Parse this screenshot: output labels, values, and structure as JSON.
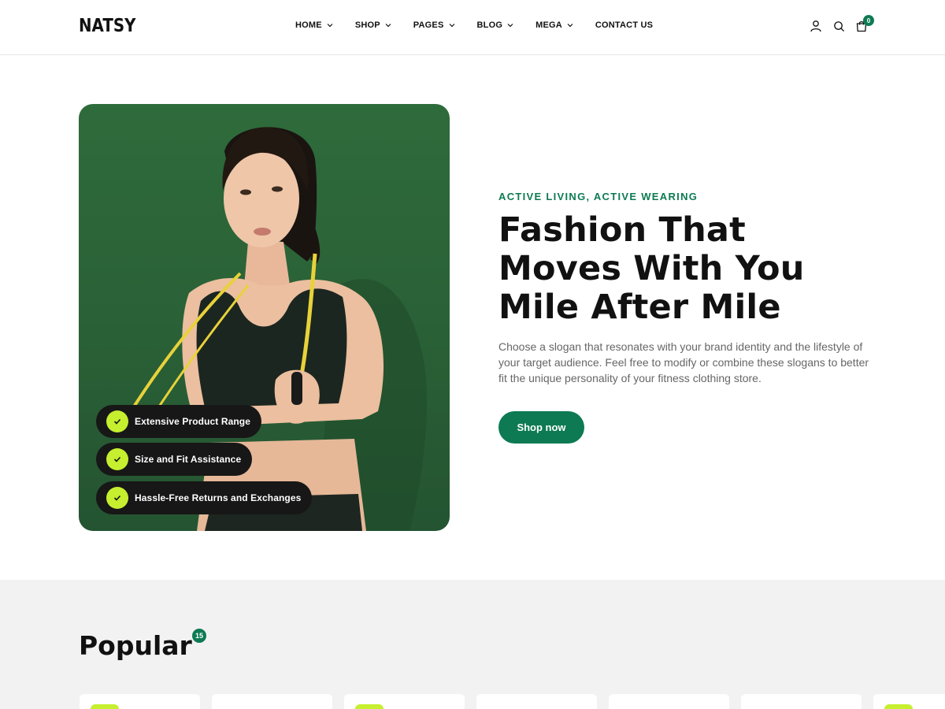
{
  "brand": {
    "logo": "NATSY"
  },
  "nav": {
    "items": [
      {
        "label": "HOME",
        "dropdown": true
      },
      {
        "label": "SHOP",
        "dropdown": true
      },
      {
        "label": "PAGES",
        "dropdown": true
      },
      {
        "label": "BLOG",
        "dropdown": true
      },
      {
        "label": "MEGA",
        "dropdown": true
      },
      {
        "label": "CONTACT US",
        "dropdown": false
      }
    ]
  },
  "header_icons": {
    "account": "user-icon",
    "search": "search-icon",
    "cart": "shopping-bag-icon",
    "cart_count": "0"
  },
  "hero": {
    "eyebrow": "ACTIVE LIVING, ACTIVE WEARING",
    "headline": [
      "Fashion That",
      "Moves With You",
      "Mile After Mile"
    ],
    "description": "Choose a slogan that resonates with your brand identity and the lifestyle of your target audience. Feel free to modify or combine these slogans to better fit the unique personality of your fitness clothing store.",
    "cta_label": "Shop now",
    "features": [
      "Extensive Product Range",
      "Size and Fit Assistance",
      "Hassle-Free Returns and Exchanges"
    ]
  },
  "popular": {
    "title": "Popular",
    "count": "15"
  },
  "colors": {
    "accent": "#0d7a53",
    "lime": "#c6ef2f",
    "dark": "#171717",
    "section_bg": "#f2f2f2",
    "hero_bg": "#2e6b3b"
  }
}
